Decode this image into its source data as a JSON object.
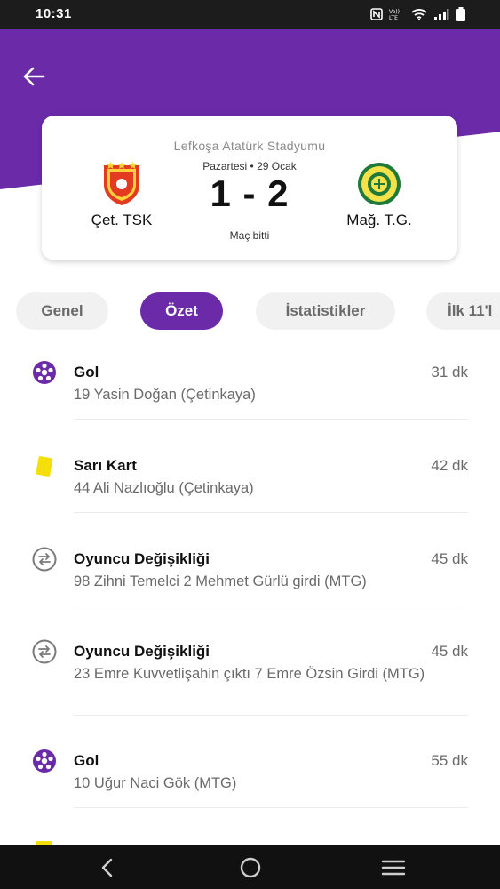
{
  "status_bar": {
    "time": "10:31"
  },
  "match": {
    "stadium": "Lefkoşa Atatürk Stadyumu",
    "date": "Pazartesi • 29 Ocak",
    "score": "1 - 2",
    "status": "Maç bitti",
    "home_team": "Çet. TSK",
    "away_team": "Mağ. T.G."
  },
  "tabs": [
    {
      "label": "Genel"
    },
    {
      "label": "Özet",
      "active": true
    },
    {
      "label": "İstatistikler"
    },
    {
      "label": "İlk 11'l"
    }
  ],
  "events": [
    {
      "icon": "soccer-ball-icon",
      "title": "Gol",
      "minute": "31 dk",
      "desc": "19 Yasin Doğan (Çetinkaya)"
    },
    {
      "icon": "yellow-card-icon",
      "title": "Sarı Kart",
      "minute": "42 dk",
      "desc": "44 Ali Nazlıoğlu (Çetinkaya)"
    },
    {
      "icon": "substitution-icon",
      "title": "Oyuncu Değişikliği",
      "minute": "45 dk",
      "desc": "98 Zihni Temelci 2 Mehmet Gürlü girdi (MTG)"
    },
    {
      "icon": "substitution-icon",
      "title": "Oyuncu Değişikliği",
      "minute": "45 dk",
      "desc": "23 Emre Kuvvetlişahin çıktı 7 Emre Özsin Girdi (MTG)"
    },
    {
      "icon": "soccer-ball-icon",
      "title": "Gol",
      "minute": "55 dk",
      "desc": "10 Uğur Naci Gök (MTG)"
    }
  ],
  "colors": {
    "primary": "#6b2aa8",
    "yellow_card": "#f5df0a"
  }
}
